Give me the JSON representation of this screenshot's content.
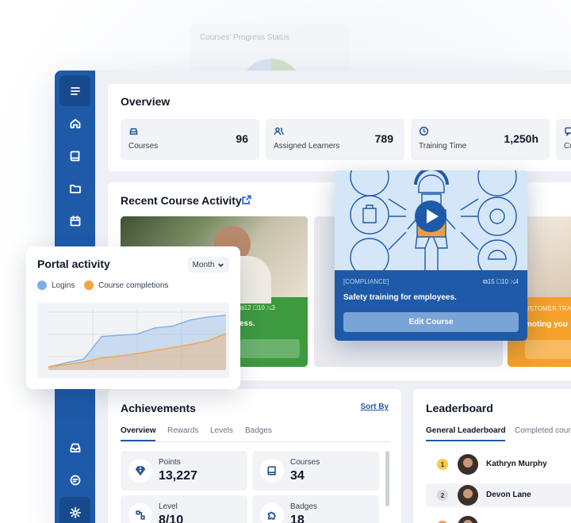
{
  "ghost": {
    "title": "Courses' Progress Status"
  },
  "sidebar": {
    "items": [
      {
        "name": "menu-icon"
      },
      {
        "name": "home-icon"
      },
      {
        "name": "book-icon"
      },
      {
        "name": "folder-icon"
      },
      {
        "name": "calendar-icon"
      },
      {
        "name": "inbox-icon"
      },
      {
        "name": "chat-icon"
      },
      {
        "name": "gear-icon"
      }
    ]
  },
  "overview": {
    "title": "Overview",
    "stats": [
      {
        "label": "Courses",
        "value": "96",
        "icon": "car-icon"
      },
      {
        "label": "Assigned Learners",
        "value": "789",
        "icon": "users-icon"
      },
      {
        "label": "Training Time",
        "value": "1,250h",
        "icon": "clock-icon"
      },
      {
        "label": "Co",
        "value": "",
        "icon": "chat-icon"
      }
    ]
  },
  "recent": {
    "title": "Recent Course Activity",
    "green": {
      "meta": "⧉12   ▢10   ⤯3",
      "text": "ess."
    },
    "orange": {
      "meta": "USTOMER TRA",
      "text": "moting you"
    }
  },
  "featured_course": {
    "category": "[COMPLIANCE]",
    "stats": "⧉15   ▢10   ⤯4",
    "title": "Safety training for employees.",
    "button": "Edit Course"
  },
  "achievements": {
    "title": "Achievements",
    "sort_label": "Sort By",
    "tabs": [
      "Overview",
      "Rewards",
      "Levels",
      "Badges"
    ],
    "tiles": [
      {
        "label": "Points",
        "value": "13,227",
        "icon": "diamond-icon"
      },
      {
        "label": "Courses",
        "value": "34",
        "icon": "book-icon"
      },
      {
        "label": "Level",
        "value": "8/10",
        "icon": "level-icon"
      },
      {
        "label": "Badges",
        "value": "18",
        "icon": "puzzle-icon"
      }
    ]
  },
  "leaderboard": {
    "title": "Leaderboard",
    "tabs": [
      "General Leaderboard",
      "Completed cour"
    ],
    "rows": [
      {
        "rank": "1",
        "name": "Kathryn Murphy",
        "rank_color": "#f7c948"
      },
      {
        "rank": "2",
        "name": "Devon Lane",
        "rank_color": "#d6d9de"
      },
      {
        "rank": "3",
        "name": "",
        "rank_color": "#f0a35a"
      }
    ]
  },
  "portal": {
    "title": "Portal activity",
    "period": "Month",
    "legend": [
      {
        "label": "Logins",
        "color": "#80aee4"
      },
      {
        "label": "Course completions",
        "color": "#f5a44c"
      }
    ]
  },
  "chart_data": {
    "type": "area",
    "xlabel": "",
    "ylabel": "",
    "ylim": [
      0,
      100
    ],
    "x": [
      0,
      1,
      2,
      3,
      4,
      5,
      6,
      7,
      8,
      9,
      10
    ],
    "series": [
      {
        "name": "Logins",
        "values": [
          5,
          12,
          18,
          55,
          57,
          59,
          69,
          72,
          82,
          87,
          90
        ],
        "color": "#80aee4"
      },
      {
        "name": "Course completions",
        "values": [
          5,
          9,
          13,
          20,
          23,
          27,
          32,
          37,
          42,
          48,
          60
        ],
        "color": "#f5a44c"
      }
    ]
  }
}
